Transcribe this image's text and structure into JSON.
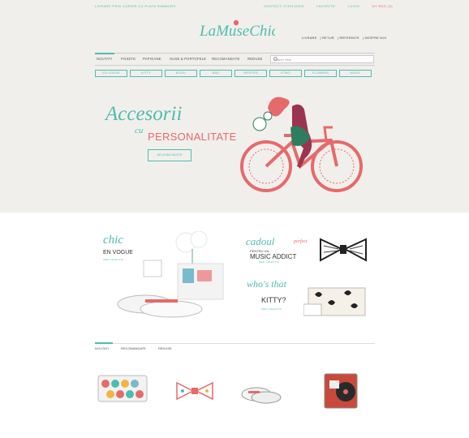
{
  "topbar": {
    "tagline": "LIVRARE PRIN CURIER CU PLATA RAMBURS",
    "links": [
      "CONTACT: 0751111000",
      "FAVORITE",
      "LOGIN",
      "MY BAG (0)"
    ]
  },
  "logo": {
    "text": "LaMuseChic"
  },
  "toplinks": [
    "LIVRARE",
    "RETUR",
    "REFERINTE",
    "DESPRE NOI"
  ],
  "nav": {
    "items": [
      "NOUTATI",
      "POSETE",
      "PAPIOANE",
      "HUSE & PORTOFELE",
      "RECOMANDATE",
      "REDUSE"
    ],
    "search_placeholder": "Search Here"
  },
  "categories": [
    "EN VOGUE",
    "KITTY",
    "BIJOU",
    "BAD",
    "HIPSTER",
    "ETNO",
    "FLOWERS",
    "MUSIC"
  ],
  "hero": {
    "title": "Accesorii",
    "cu": "cu",
    "subtitle": "PERSONALITATE",
    "button": "AFLA MAI MULTE"
  },
  "promos": {
    "p1": {
      "script": "chic",
      "title": "EN VOGUE",
      "link": "VEZI COLECTIA"
    },
    "p2": {
      "script": "cadoul",
      "script2": "perfect",
      "pre": "PENTRU UN",
      "title": "MUSIC ADDICT",
      "link": "VEZI COLECTIA"
    },
    "p3": {
      "script": "who's that",
      "title": "KITTY?",
      "link": "VEZI COLECTIA"
    }
  },
  "tabs": [
    "NOUTATI",
    "RECOMANDATE",
    "REDUSE"
  ],
  "colors": {
    "accent": "#4dbdb0",
    "coral": "#e66a6a",
    "hero_bg": "#f1efec"
  }
}
